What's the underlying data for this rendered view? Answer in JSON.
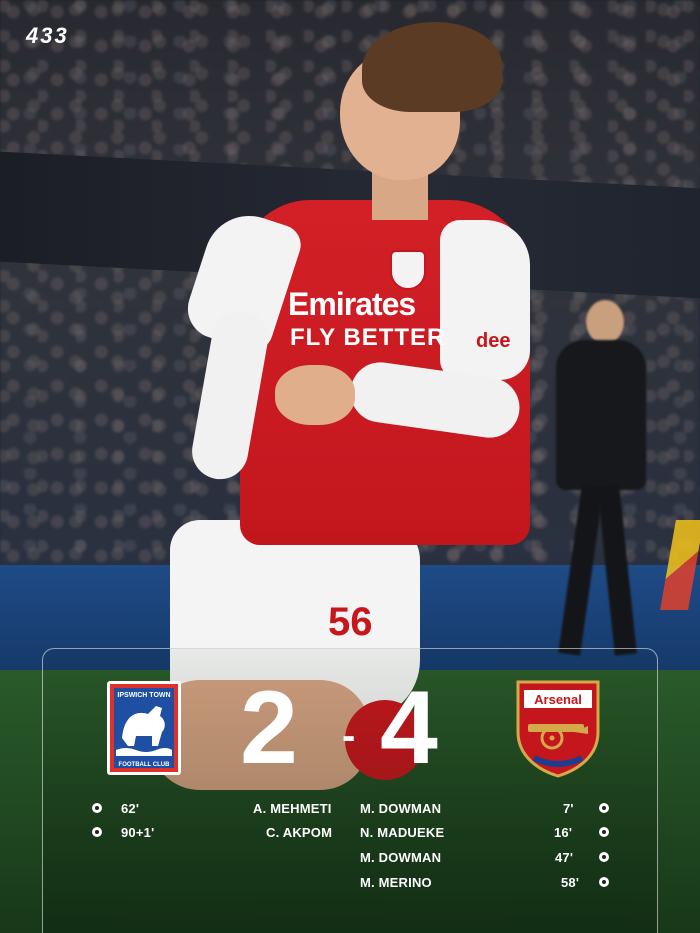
{
  "brand": {
    "logo_text": "433"
  },
  "photo": {
    "jersey_sponsor_line1": "Emirates",
    "jersey_sponsor_line2": "FLY BETTER",
    "jersey_number": "56",
    "sleeve_sponsor": "dee"
  },
  "match": {
    "home_team": {
      "name": "Ipswich Town",
      "crest_text_top": "IPSWICH TOWN",
      "crest_text_bottom": "FOOTBALL CLUB",
      "score": "2"
    },
    "away_team": {
      "name": "Arsenal",
      "crest_text": "Arsenal",
      "score": "4"
    },
    "separator": "-"
  },
  "goals": {
    "home": [
      {
        "minute": "62'",
        "scorer": "A. MEHMETI"
      },
      {
        "minute": "90+1'",
        "scorer": "C. AKPOM"
      }
    ],
    "away": [
      {
        "scorer": "M. DOWMAN",
        "minute": "7'"
      },
      {
        "scorer": "N. MADUEKE",
        "minute": "16'"
      },
      {
        "scorer": "M. DOWMAN",
        "minute": "47'"
      },
      {
        "scorer": "M. MERINO",
        "minute": "58'"
      }
    ]
  },
  "colors": {
    "arsenal_red": "#c4161c",
    "ipswich_blue": "#1f4fa3",
    "text": "#ffffff"
  }
}
